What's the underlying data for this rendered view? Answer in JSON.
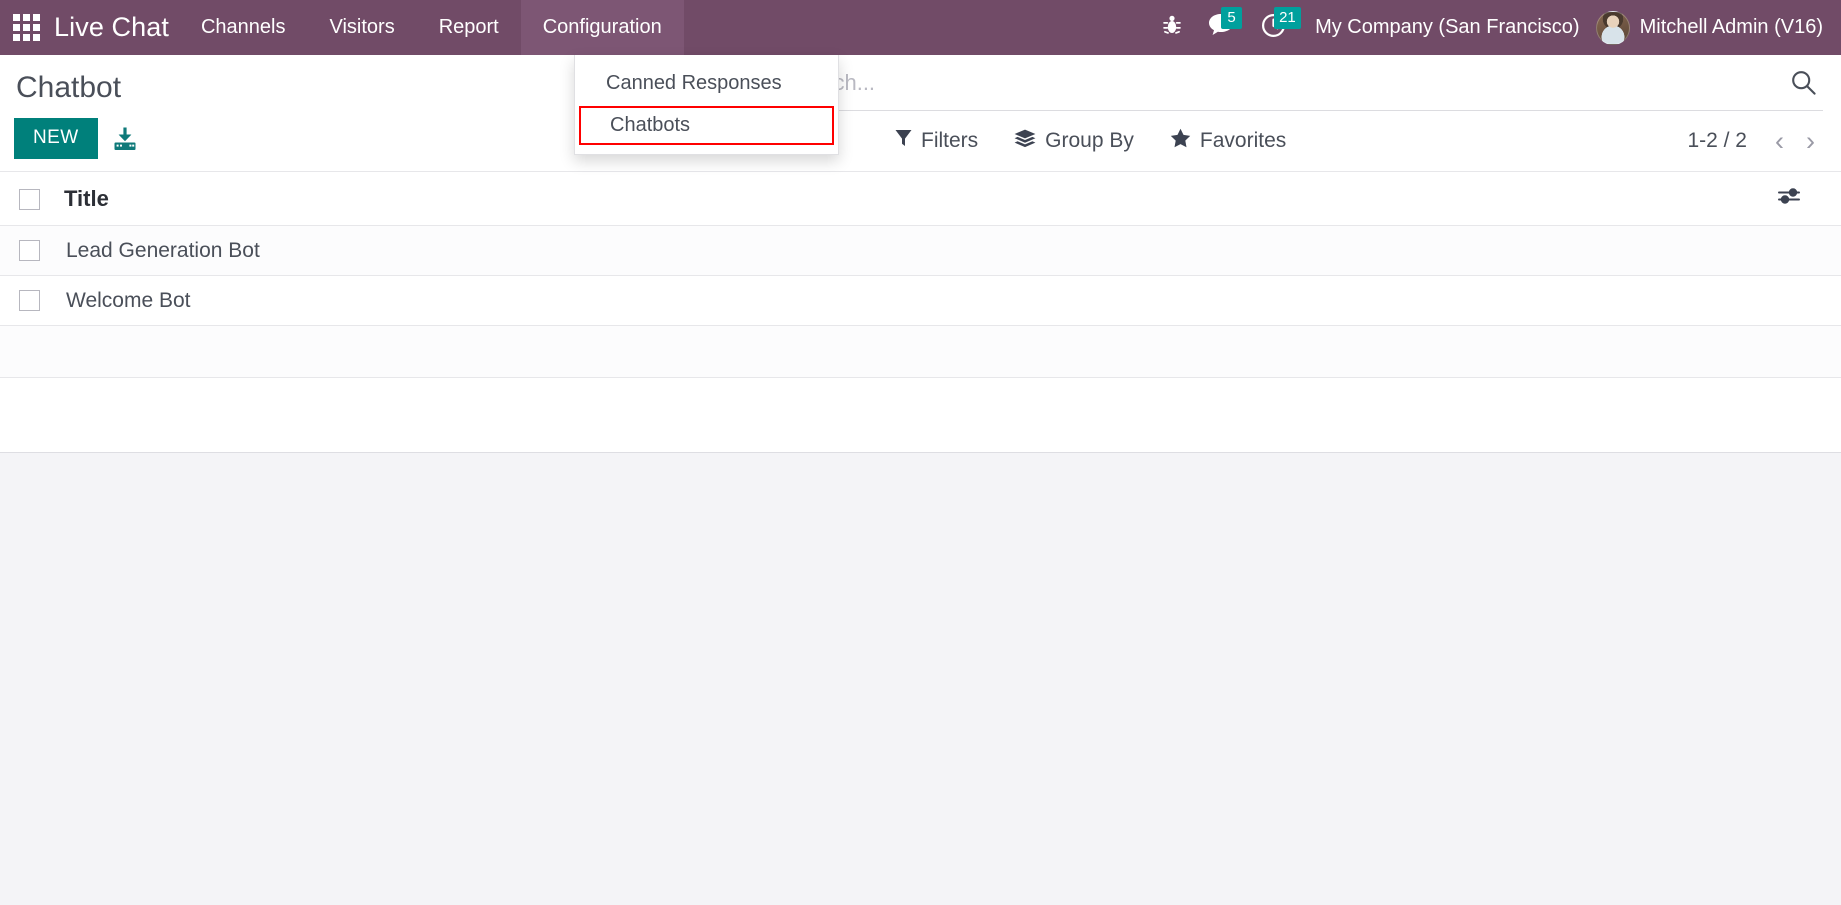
{
  "navbar": {
    "apps_icon": "apps-grid-icon",
    "brand": "Live Chat",
    "menu": [
      {
        "label": "Channels",
        "active": false
      },
      {
        "label": "Visitors",
        "active": false
      },
      {
        "label": "Report",
        "active": false
      },
      {
        "label": "Configuration",
        "active": true
      }
    ],
    "right": {
      "bug_icon": "bug-icon",
      "messages_icon": "messages-icon",
      "messages_count": "5",
      "activities_icon": "clock-activity-icon",
      "activities_count": "21",
      "company": "My Company (San Francisco)",
      "avatar": "user-avatar",
      "user": "Mitchell Admin (V16)"
    },
    "accent_color": "#714B67",
    "badge_color": "#00a09d"
  },
  "dropdown": {
    "items": [
      {
        "label": "Canned Responses",
        "highlighted": false
      },
      {
        "label": "Chatbots",
        "highlighted": true
      }
    ],
    "highlight_color": "#ff0000"
  },
  "control_panel": {
    "title": "Chatbot",
    "new_button": "NEW",
    "import_icon": "import-download-icon",
    "search": {
      "placeholder": "Search...",
      "value": "",
      "icon": "search-icon"
    },
    "tools": [
      {
        "label": "Filters",
        "icon": "filter-funnel-icon"
      },
      {
        "label": "Group By",
        "icon": "layers-stack-icon"
      },
      {
        "label": "Favorites",
        "icon": "star-icon"
      }
    ],
    "pager": {
      "count": "1-2 / 2",
      "prev_icon": "chevron-left-icon",
      "next_icon": "chevron-right-icon"
    },
    "new_button_color": "#00807b"
  },
  "list_view": {
    "select_all_checkbox": "unchecked",
    "columns": [
      "Title"
    ],
    "optional_columns_icon": "sliders-options-icon",
    "rows": [
      {
        "checkbox": "unchecked",
        "title": "Lead Generation Bot"
      },
      {
        "checkbox": "unchecked",
        "title": "Welcome Bot"
      }
    ]
  }
}
